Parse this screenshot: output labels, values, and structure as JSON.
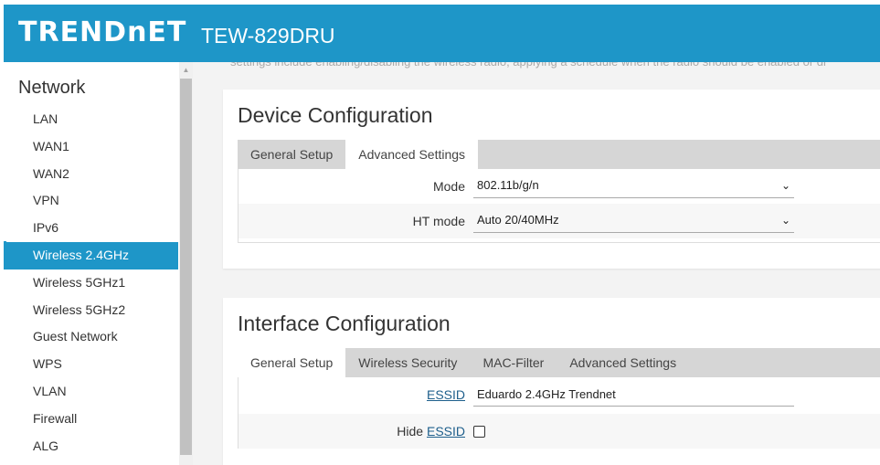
{
  "header": {
    "logo": "TRENDnET",
    "model": "TEW-829DRU"
  },
  "sidebar": {
    "title": "Network",
    "items": [
      {
        "label": "LAN"
      },
      {
        "label": "WAN1"
      },
      {
        "label": "WAN2"
      },
      {
        "label": "VPN"
      },
      {
        "label": "IPv6"
      },
      {
        "label": "Wireless 2.4GHz",
        "active": true
      },
      {
        "label": "Wireless 5GHz1"
      },
      {
        "label": "Wireless 5GHz2"
      },
      {
        "label": "Guest Network"
      },
      {
        "label": "WPS"
      },
      {
        "label": "VLAN"
      },
      {
        "label": "Firewall"
      },
      {
        "label": "ALG"
      }
    ]
  },
  "content": {
    "intro": "settings include enabling/disabling the wireless radio, applying a schedule when the radio should be enabled or di",
    "device_config": {
      "title": "Device Configuration",
      "tabs": [
        "General Setup",
        "Advanced Settings"
      ],
      "active_tab": "Advanced Settings",
      "fields": {
        "mode": {
          "label": "Mode",
          "value": "802.11b/g/n"
        },
        "ht_mode": {
          "label": "HT mode",
          "value": "Auto 20/40MHz"
        }
      }
    },
    "interface_config": {
      "title": "Interface Configuration",
      "tabs": [
        "General Setup",
        "Wireless Security",
        "MAC-Filter",
        "Advanced Settings"
      ],
      "active_tab": "General Setup",
      "fields": {
        "essid": {
          "label": "ESSID",
          "value": "Eduardo 2.4GHz Trendnet"
        },
        "hide_essid": {
          "label_prefix": "Hide",
          "label_link": "ESSID",
          "checked": false
        }
      }
    }
  },
  "icons": {
    "dropdown": "chevron-down-icon",
    "scroll_up": "triangle-up-icon"
  },
  "colors": {
    "brand": "#1e96c8",
    "link": "#1e5f8c"
  }
}
